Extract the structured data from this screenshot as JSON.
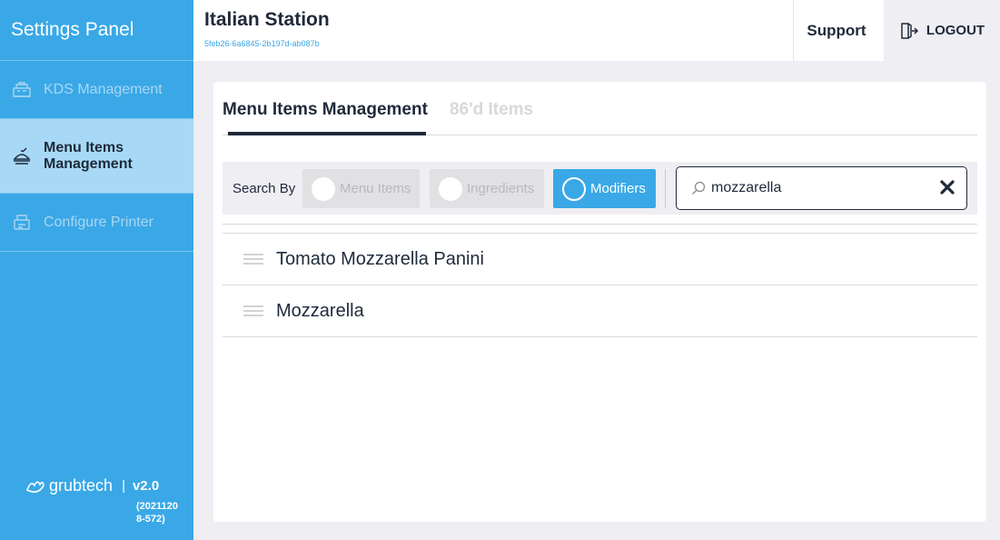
{
  "sidebar": {
    "title": "Settings Panel",
    "items": [
      {
        "label": "KDS Management",
        "icon": "kds-icon",
        "state": "disabled"
      },
      {
        "label": "Menu Items Management",
        "icon": "menu-items-icon",
        "state": "active"
      },
      {
        "label": "Configure Printer",
        "icon": "printer-icon",
        "state": "disabled"
      }
    ],
    "brand": "grubtech",
    "separator": "|",
    "version": "v2.0",
    "build": "(20211208-572)"
  },
  "topbar": {
    "station_name": "Italian Station",
    "station_id": "5feb26-6a6845-2b197d-ab087b",
    "support_label": "Support",
    "logout_label": "LOGOUT"
  },
  "main": {
    "tabs": [
      {
        "label": "Menu Items Management",
        "active": true
      },
      {
        "label": "86'd Items",
        "active": false
      }
    ],
    "search": {
      "label": "Search By",
      "options": [
        {
          "label": "Menu Items",
          "selected": false
        },
        {
          "label": "Ingredients",
          "selected": false
        },
        {
          "label": "Modifiers",
          "selected": true
        }
      ],
      "value": "mozzarella"
    },
    "results": [
      {
        "name": "Tomato Mozzarella Panini"
      },
      {
        "name": "Mozzarella"
      }
    ]
  },
  "colors": {
    "accent": "#3aa8e6",
    "dark": "#1f2a3a",
    "background": "#efeef3"
  }
}
